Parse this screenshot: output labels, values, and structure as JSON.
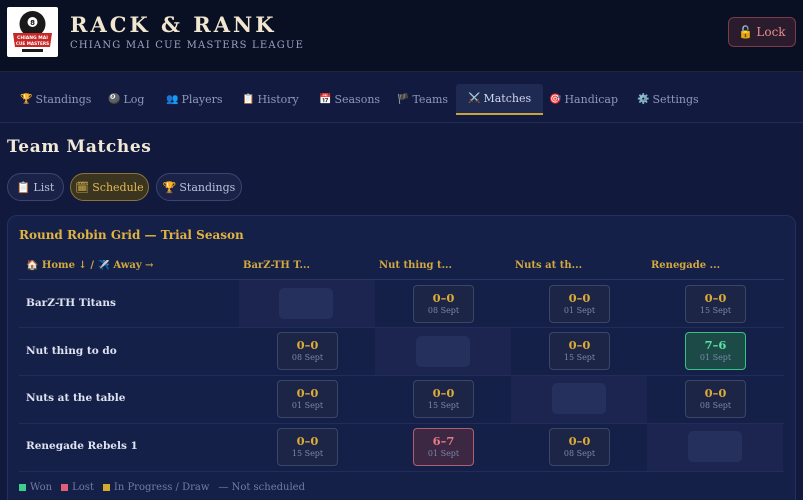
{
  "app": {
    "title": "RACK & RANK",
    "subtitle": "CHIANG MAI CUE MASTERS LEAGUE",
    "logo_text": "CHIANG MAI CUE MASTERS",
    "lock_label": "Lock",
    "lock_icon": "🔓"
  },
  "nav": [
    {
      "icon": "🏆",
      "label": "Standings"
    },
    {
      "icon": "🎱",
      "label": "Log"
    },
    {
      "icon": "👥",
      "label": "Players"
    },
    {
      "icon": "📋",
      "label": "History"
    },
    {
      "icon": "📅",
      "label": "Seasons"
    },
    {
      "icon": "🏴",
      "label": "Teams"
    },
    {
      "icon": "⚔️",
      "label": "Matches",
      "active": true
    },
    {
      "icon": "🎯",
      "label": "Handicap"
    },
    {
      "icon": "⚙️",
      "label": "Settings"
    }
  ],
  "page": {
    "title": "Team Matches",
    "subtabs": [
      {
        "icon": "📋",
        "label": "List"
      },
      {
        "icon": "🗓",
        "label": "Schedule",
        "active": true
      },
      {
        "icon": "🏆",
        "label": "Standings"
      }
    ]
  },
  "grid": {
    "title": "Round Robin Grid — Trial Season",
    "corner_label": "🏠 Home ↓ / ✈️ Away →",
    "columns": [
      "BarZ-TH T...",
      "Nut thing t...",
      "Nuts at th...",
      "Renegade ..."
    ],
    "rows": [
      {
        "label": "BarZ-TH Titans",
        "cells": [
          null,
          {
            "score": "0–0",
            "date": "08 Sept",
            "status": "pending"
          },
          {
            "score": "0–0",
            "date": "01 Sept",
            "status": "pending"
          },
          {
            "score": "0–0",
            "date": "15 Sept",
            "status": "pending"
          }
        ]
      },
      {
        "label": "Nut thing to do",
        "cells": [
          {
            "score": "0–0",
            "date": "08 Sept",
            "status": "pending"
          },
          null,
          {
            "score": "0–0",
            "date": "15 Sept",
            "status": "pending"
          },
          {
            "score": "7–6",
            "date": "01 Sept",
            "status": "won"
          }
        ]
      },
      {
        "label": "Nuts at the table",
        "cells": [
          {
            "score": "0–0",
            "date": "01 Sept",
            "status": "pending"
          },
          {
            "score": "0–0",
            "date": "15 Sept",
            "status": "pending"
          },
          null,
          {
            "score": "0–0",
            "date": "08 Sept",
            "status": "pending"
          }
        ]
      },
      {
        "label": "Renegade Rebels 1",
        "cells": [
          {
            "score": "0–0",
            "date": "15 Sept",
            "status": "pending"
          },
          {
            "score": "6–7",
            "date": "01 Sept",
            "status": "lost"
          },
          {
            "score": "0–0",
            "date": "08 Sept",
            "status": "pending"
          },
          null
        ]
      }
    ]
  },
  "legend": [
    {
      "label": "Won",
      "color": "#3ecf8e"
    },
    {
      "label": "Lost",
      "color": "#e0607a"
    },
    {
      "label": "In Progress / Draw",
      "color": "#d4a92e"
    },
    {
      "label": "— Not scheduled",
      "color": null
    }
  ],
  "colors": {
    "accent_gold": "#d4a92e",
    "won": "#3ecf8e",
    "lost": "#e0607a",
    "background": "#111a3c"
  }
}
